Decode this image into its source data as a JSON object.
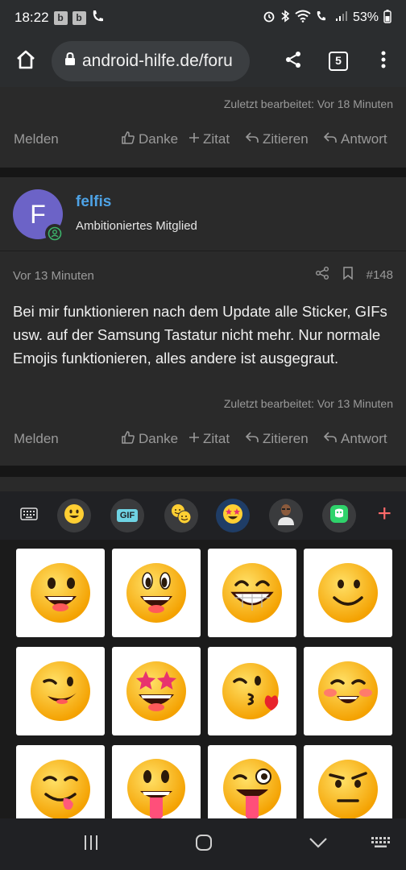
{
  "status": {
    "time": "18:22",
    "notif_b1": "b",
    "notif_b2": "b",
    "battery": "53%"
  },
  "browser": {
    "url": "android-hilfe.de/foru",
    "tab_count": "5",
    "icons": [
      "home-icon",
      "lock-icon",
      "share-icon",
      "tab-switcher-icon",
      "more-icon"
    ]
  },
  "post_prev": {
    "edited": "Zuletzt bearbeitet: Vor 18 Minuten",
    "actions": {
      "melden": "Melden",
      "danke": "Danke",
      "zitat": "Zitat",
      "zitieren": "Zitieren",
      "antwort": "Antwort"
    }
  },
  "post": {
    "avatar_letter": "F",
    "avatar_color": "#6c63c7",
    "username": "felfis",
    "rank": "Ambitioniertes Mitglied",
    "date": "Vor 13 Minuten",
    "number": "#148",
    "body": "Bei mir funktionieren nach dem Update alle Sticker, GIFs usw. auf der Samsung Tastatur nicht mehr. Nur normale Emojis funktionieren, alles andere ist ausgegraut.",
    "edited": "Zuletzt bearbeitet: Vor 13 Minuten",
    "actions": {
      "melden": "Melden",
      "danke": "Danke",
      "zitat": "Zitat",
      "zitieren": "Zitieren",
      "antwort": "Antwort"
    }
  },
  "keyboard": {
    "toolbar": {
      "gif_label": "GIF",
      "categories": [
        "keyboard-icon",
        "emoji-icon",
        "gif-icon",
        "emoji-pair-icon",
        "star-eyes-sticker-icon",
        "avatar-sticker-icon",
        "bitmoji-icon",
        "add-icon"
      ]
    },
    "stickers": [
      "grinning-face",
      "beaming-face",
      "big-grin-face",
      "smiling-face",
      "winking-face",
      "star-struck-face",
      "kissing-face",
      "blushing-face",
      "yum-face",
      "tongue-out-face",
      "zany-face",
      "suspicious-face"
    ],
    "accent_color": "#ff6b6b"
  },
  "navbar": {
    "icons": [
      "recents-icon",
      "home-nav-icon",
      "back-icon",
      "keyboard-switch-icon"
    ]
  }
}
